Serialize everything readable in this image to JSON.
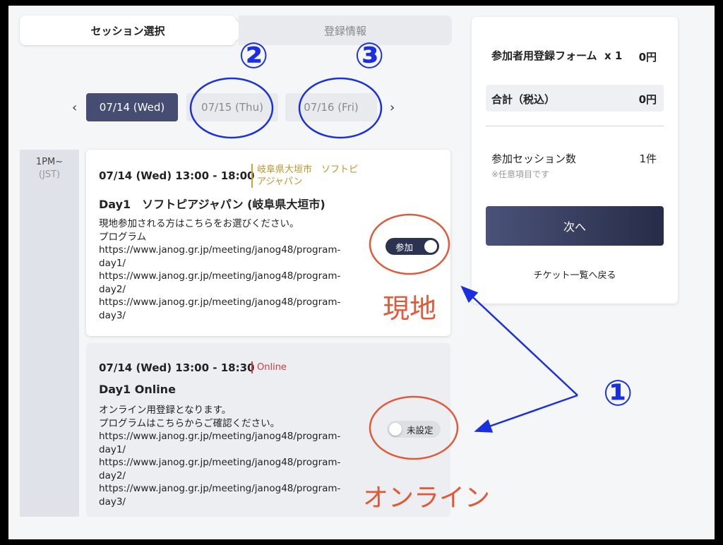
{
  "tabs": {
    "session_select": "セッション選択",
    "registration_info": "登録情報"
  },
  "date_nav": {
    "prev": "‹",
    "next": "›",
    "dates": [
      "07/14 (Wed)",
      "07/15 (Thu)",
      "07/16 (Fri)"
    ]
  },
  "time_slot": {
    "time": "1PM~",
    "tz": "(JST)"
  },
  "sessions": [
    {
      "datetime": "07/14 (Wed) 13:00 - 18:00",
      "location_line1": "岐阜県大垣市　ソフトピ",
      "location_line2": "アジャパン",
      "title": "Day1　ソフトピアジャパン (岐阜県大垣市)",
      "desc": [
        "現地参加される方はこちらをお選びください。",
        "プログラム",
        "https://www.janog.gr.jp/meeting/janog48/program-",
        "day1/",
        "https://www.janog.gr.jp/meeting/janog48/program-",
        "day2/",
        "https://www.janog.gr.jp/meeting/janog48/program-",
        "day3/"
      ],
      "toggle_label": "参加",
      "toggle_on": true
    },
    {
      "datetime": "07/14 (Wed) 13:00 - 18:30",
      "location_line1": "Online",
      "title": "Day1 Online",
      "desc": [
        "オンライン用登録となります。",
        "プログラムはこちらからご確認ください。",
        "https://www.janog.gr.jp/meeting/janog48/program-",
        "day1/",
        "https://www.janog.gr.jp/meeting/janog48/program-",
        "day2/",
        "https://www.janog.gr.jp/meeting/janog48/program-",
        "day3/"
      ],
      "toggle_label": "未設定",
      "toggle_on": false
    }
  ],
  "summary": {
    "form_name": "参加者用登録フォーム",
    "qty": "x 1",
    "price": "0円",
    "total_label": "合計（税込）",
    "total_value": "0円",
    "session_count_label": "参加セッション数",
    "session_count_value": "1件",
    "optional_note": "※任意項目です",
    "next_button": "次へ",
    "back_link": "チケット一覧へ戻る"
  },
  "annotations": {
    "num1": "①",
    "num2": "②",
    "num3": "③",
    "label_onsite": "現地",
    "label_online": "オンライン",
    "circle_color": "#1a30e0",
    "highlight_color": "#e05a3a"
  }
}
